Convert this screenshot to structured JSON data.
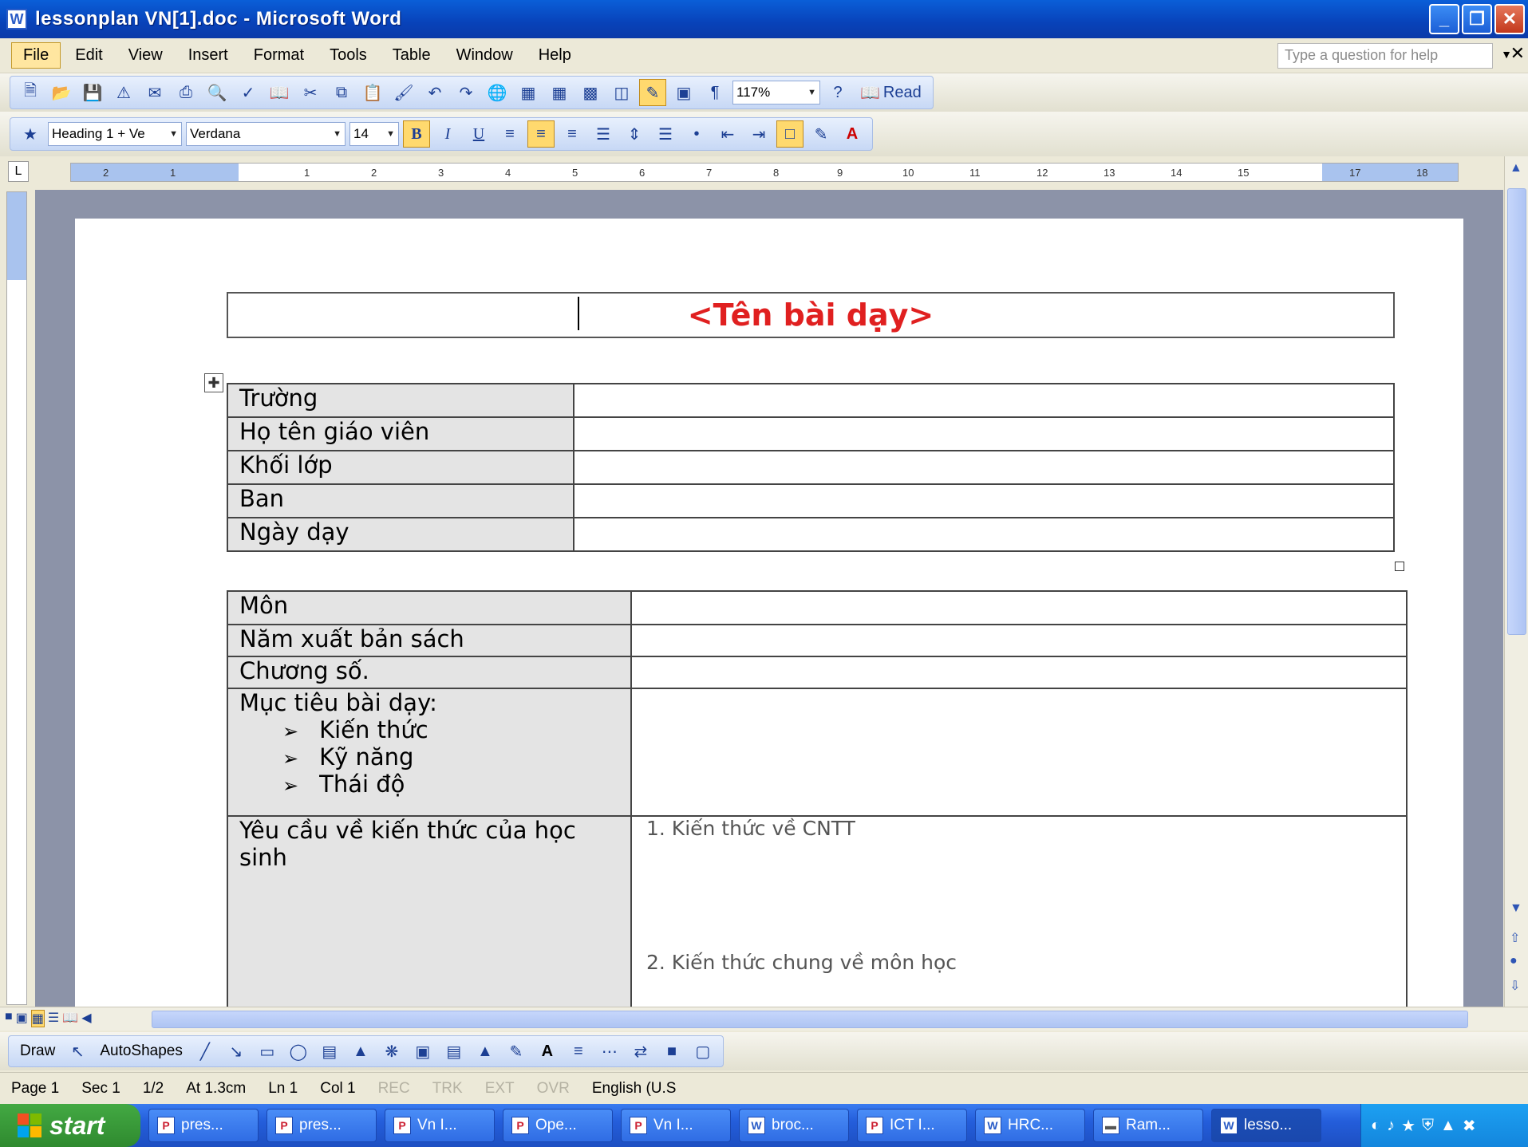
{
  "window": {
    "title": "lessonplan VN[1].doc - Microsoft Word",
    "app_icon": "word-doc-icon"
  },
  "menu": {
    "items": [
      "File",
      "Edit",
      "View",
      "Insert",
      "Format",
      "Tools",
      "Table",
      "Window",
      "Help"
    ],
    "active": "File",
    "help_placeholder": "Type a question for help"
  },
  "standard_toolbar": {
    "zoom": "117%",
    "read_label": "Read"
  },
  "formatting_toolbar": {
    "style": "Heading 1 + Ve",
    "font": "Verdana",
    "size": "14"
  },
  "ruler": {
    "numbers": [
      "2",
      "1",
      "1",
      "2",
      "3",
      "4",
      "5",
      "6",
      "7",
      "8",
      "9",
      "10",
      "11",
      "12",
      "13",
      "14",
      "15",
      "17",
      "18"
    ]
  },
  "document": {
    "title": "<Tên bài dạy>",
    "table1": [
      {
        "label": "Trường",
        "value": ""
      },
      {
        "label": "Họ tên giáo viên",
        "value": ""
      },
      {
        "label": "Khối lớp",
        "value": ""
      },
      {
        "label": "Ban",
        "value": ""
      },
      {
        "label": "Ngày dạy",
        "value": ""
      }
    ],
    "table2": {
      "mon": "Môn",
      "nam": "Năm xuất bản sách",
      "chuong": "Chương số.",
      "muc_tieu": "Mục tiêu bài dạy:",
      "bullets": [
        "Kiến thức",
        "Kỹ năng",
        "Thái độ"
      ],
      "yeu_cau": "Yêu cầu về kiến thức của học sinh",
      "req1": "1. Kiến thức về CNTT",
      "req2": "2. Kiến thức chung về môn học"
    }
  },
  "drawing_toolbar": {
    "draw_label": "Draw",
    "autoshapes_label": "AutoShapes"
  },
  "status": {
    "page": "Page 1",
    "sec": "Sec 1",
    "pages": "1/2",
    "at": "At 1.3cm",
    "ln": "Ln 1",
    "col": "Col 1",
    "rec": "REC",
    "trk": "TRK",
    "ext": "EXT",
    "ovr": "OVR",
    "lang": "English (U.S"
  },
  "taskbar": {
    "start_label": "start",
    "buttons": [
      "pres...",
      "pres...",
      "Vn I...",
      "Ope...",
      "Vn I...",
      "broc...",
      "ICT I...",
      "HRC...",
      "Ram...",
      "lesso..."
    ],
    "active_index": 9
  },
  "colors": {
    "title_red": "#e02020",
    "titlebar_blue": "#0842b9",
    "label_gray": "#e4e4e4"
  }
}
